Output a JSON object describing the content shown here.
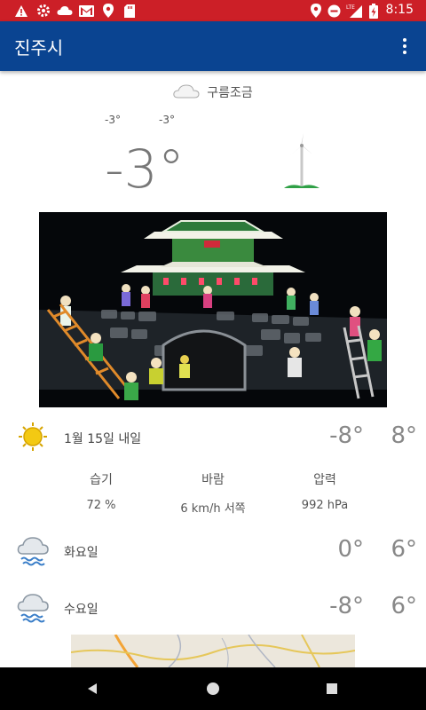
{
  "status_bar": {
    "time": "8:15",
    "left_icons": [
      "warning-icon",
      "settings-icon",
      "cloud-icon",
      "gmail-icon",
      "location-icon",
      "sd-card-icon"
    ],
    "right_icons": [
      "location-icon",
      "do-not-disturb-icon",
      "lte-signal-icon",
      "battery-charging-icon"
    ],
    "color": "#cc1f27"
  },
  "app_bar": {
    "title": "진주시",
    "color": "#0a4491",
    "menu_icon": "more-vert-icon"
  },
  "current": {
    "condition": "구름조금",
    "condition_icon": "cloud-icon",
    "low": "-3°",
    "high": "-3°",
    "temp": "-3°",
    "wind_icon": "wind-turbine-icon"
  },
  "forecast": [
    {
      "label": "1월 15일 내일",
      "min": "-8°",
      "max": "8°",
      "icon": "sun-icon"
    },
    {
      "label": "화요일",
      "min": "0°",
      "max": "6°",
      "icon": "rain-cloud-icon"
    },
    {
      "label": "수요일",
      "min": "-8°",
      "max": "6°",
      "icon": "rain-cloud-icon"
    }
  ],
  "details": {
    "humidity": {
      "label": "습기",
      "value": "72 %"
    },
    "wind": {
      "label": "바람",
      "value": "6 km/h 서쪽"
    },
    "pressure": {
      "label": "압력",
      "value": "992 hPa"
    }
  },
  "nav_bar": {
    "icons": [
      "back-icon",
      "home-icon",
      "recents-icon"
    ]
  }
}
